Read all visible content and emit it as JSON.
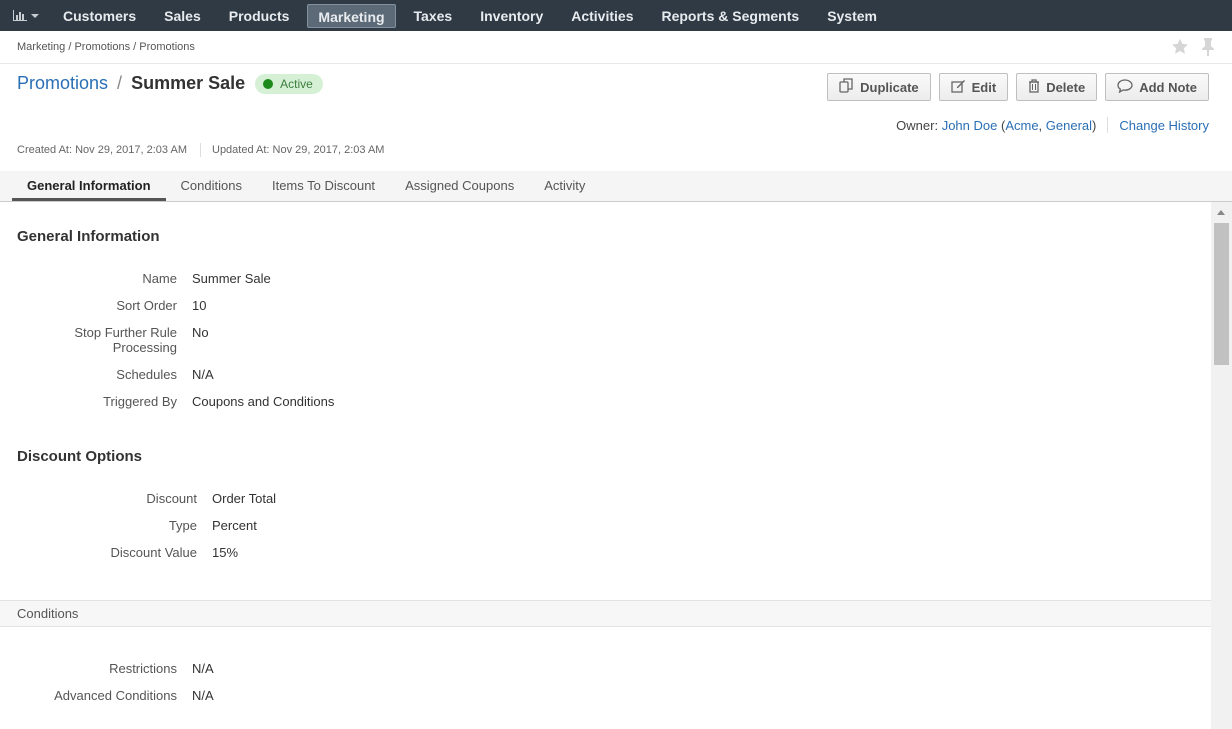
{
  "nav": {
    "items": [
      {
        "label": "Customers",
        "active": false
      },
      {
        "label": "Sales",
        "active": false
      },
      {
        "label": "Products",
        "active": false
      },
      {
        "label": "Marketing",
        "active": true
      },
      {
        "label": "Taxes",
        "active": false
      },
      {
        "label": "Inventory",
        "active": false
      },
      {
        "label": "Activities",
        "active": false
      },
      {
        "label": "Reports & Segments",
        "active": false
      },
      {
        "label": "System",
        "active": false
      }
    ]
  },
  "breadcrumb": {
    "text": "Marketing / Promotions / Promotions"
  },
  "title": {
    "parent": "Promotions",
    "separator": "/",
    "name": "Summer Sale",
    "status": "Active"
  },
  "actions": {
    "duplicate": "Duplicate",
    "edit": "Edit",
    "delete": "Delete",
    "add_note": "Add Note"
  },
  "owner": {
    "label": "Owner:",
    "name": "John Doe",
    "org_open": "(",
    "org_1": "Acme",
    "org_comma": ",",
    "org_2": "General",
    "org_close": ")",
    "change_history": "Change History"
  },
  "meta": {
    "created": "Created At: Nov 29, 2017, 2:03 AM",
    "updated": "Updated At: Nov 29, 2017, 2:03 AM"
  },
  "tabs": [
    {
      "label": "General Information",
      "active": true
    },
    {
      "label": "Conditions",
      "active": false
    },
    {
      "label": "Items To Discount",
      "active": false
    },
    {
      "label": "Assigned Coupons",
      "active": false
    },
    {
      "label": "Activity",
      "active": false
    }
  ],
  "general": {
    "title": "General Information",
    "fields": [
      {
        "label": "Name",
        "value": "Summer Sale"
      },
      {
        "label": "Sort Order",
        "value": "10"
      },
      {
        "label": "Stop Further Rule Processing",
        "value": "No"
      },
      {
        "label": "Schedules",
        "value": "N/A"
      },
      {
        "label": "Triggered By",
        "value": "Coupons and Conditions"
      }
    ]
  },
  "discount": {
    "title": "Discount Options",
    "fields": [
      {
        "label": "Discount",
        "value": "Order Total"
      },
      {
        "label": "Type",
        "value": "Percent"
      },
      {
        "label": "Discount Value",
        "value": "15%"
      }
    ]
  },
  "conditions": {
    "title": "Conditions",
    "fields": [
      {
        "label": "Restrictions",
        "value": "N/A"
      },
      {
        "label": "Advanced Conditions",
        "value": "N/A"
      }
    ]
  },
  "colors": {
    "nav_bg": "#2f3a45",
    "link": "#2a6fb5",
    "status_green": "#1b8a1b"
  }
}
